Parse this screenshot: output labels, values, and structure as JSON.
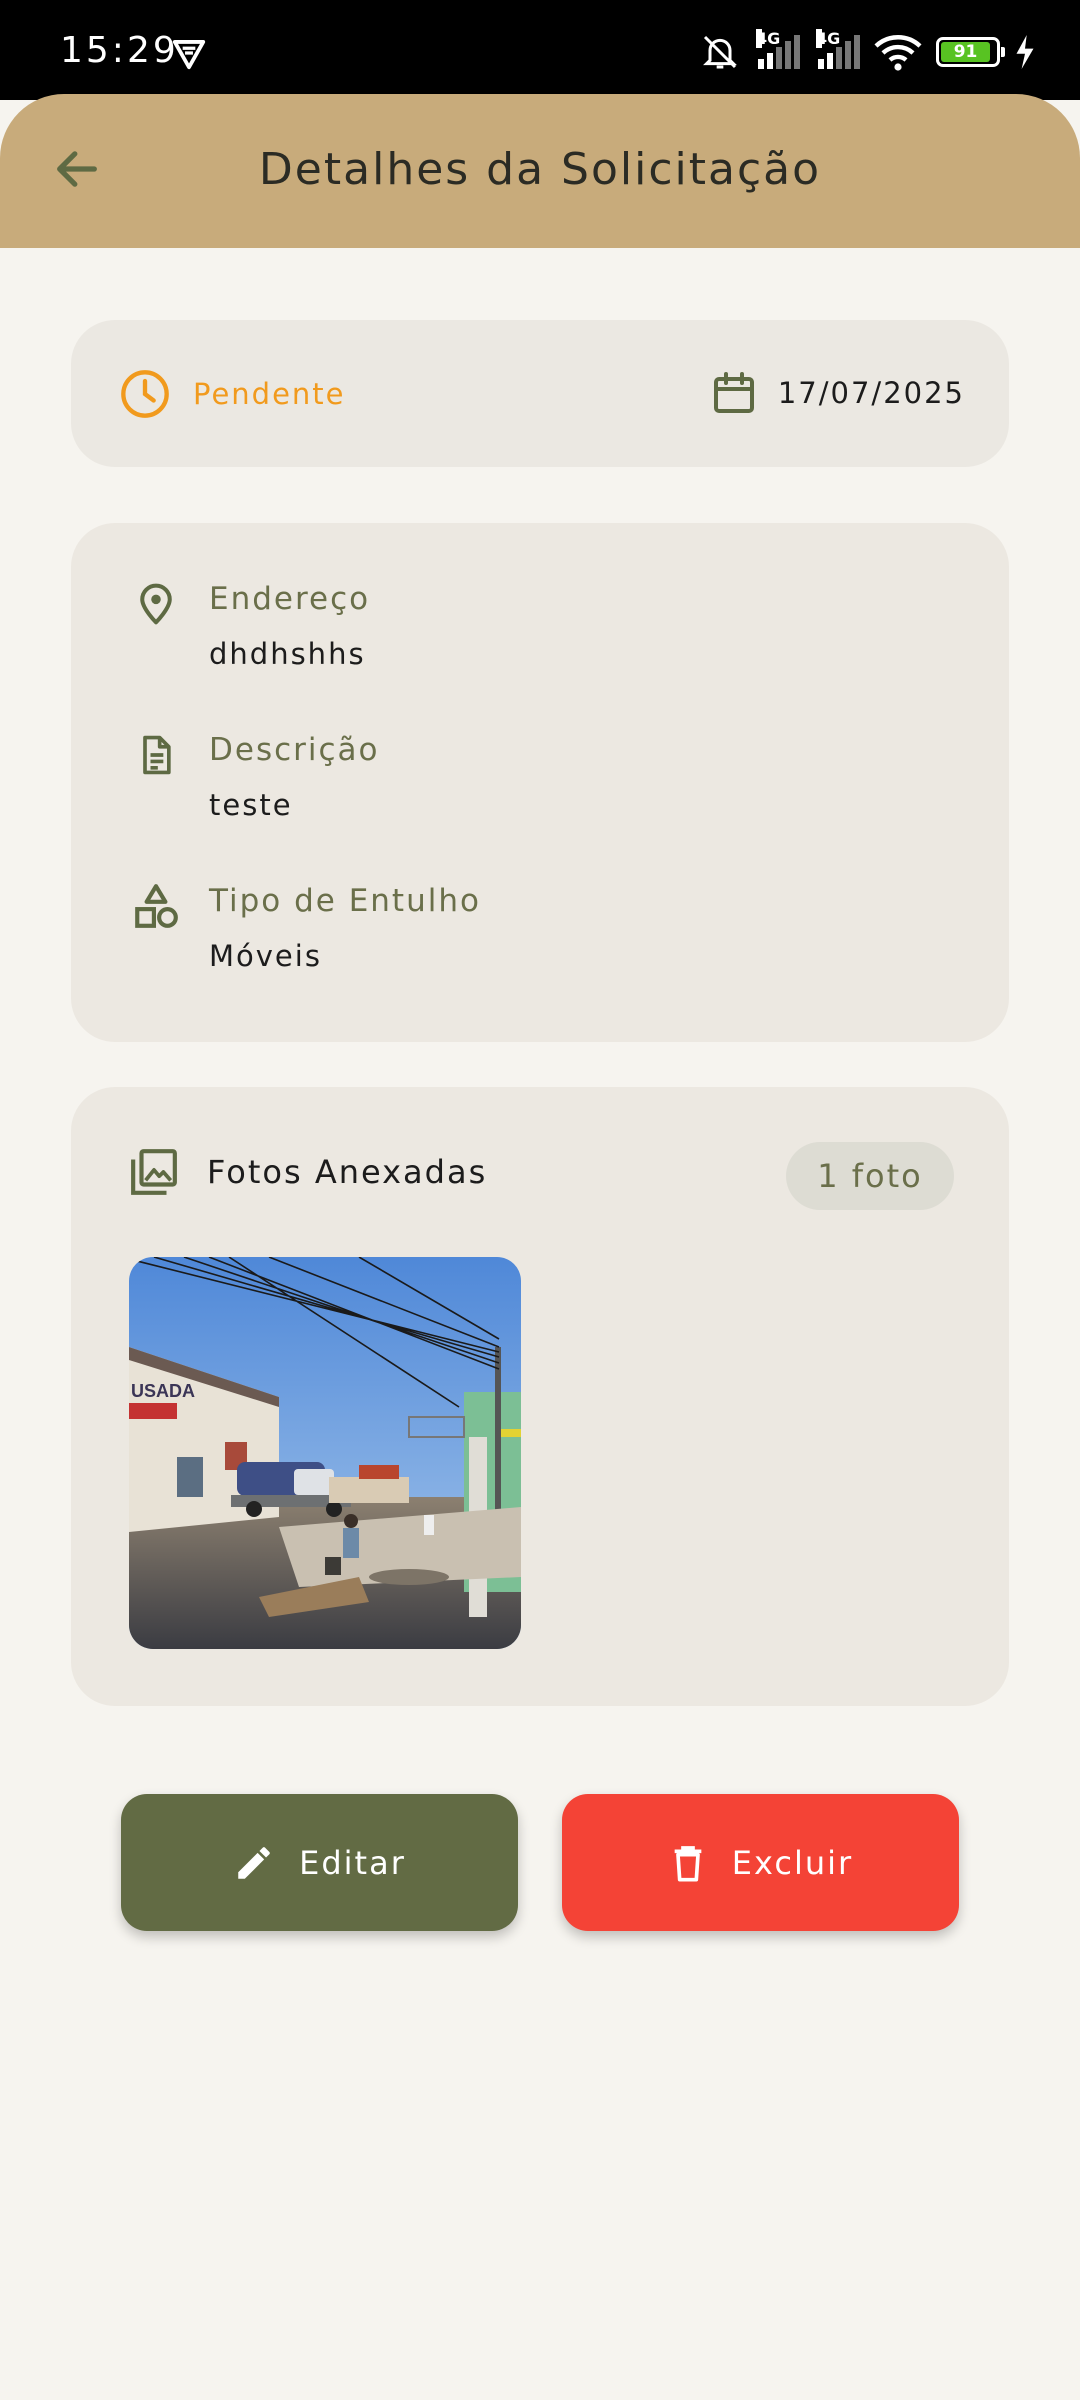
{
  "status_bar": {
    "time": "15:29",
    "network_1": "4G",
    "network_2": "4G",
    "battery": "91"
  },
  "app_bar": {
    "title": "Detalhes da Solicitação",
    "back_icon": "arrow-back-icon"
  },
  "status_card": {
    "status_icon": "clock-icon",
    "status": "Pendente",
    "status_color": "#f19a1d",
    "date_icon": "calendar-icon",
    "date": "17/07/2025"
  },
  "details": {
    "address": {
      "icon": "location-pin-icon",
      "label": "Endereço",
      "value": "dhdhshhs"
    },
    "description": {
      "icon": "document-icon",
      "label": "Descrição",
      "value": "teste"
    },
    "debris_type": {
      "icon": "shapes-icon",
      "label": "Tipo de Entulho",
      "value": "Móveis"
    }
  },
  "photos": {
    "icon": "photo-library-icon",
    "title": "Fotos Anexadas",
    "count": "1 foto"
  },
  "actions": {
    "edit_label": "Editar",
    "edit_icon": "pencil-icon",
    "edit_color": "#626b44",
    "delete_label": "Excluir",
    "delete_icon": "trash-icon",
    "delete_color": "#f44336"
  }
}
